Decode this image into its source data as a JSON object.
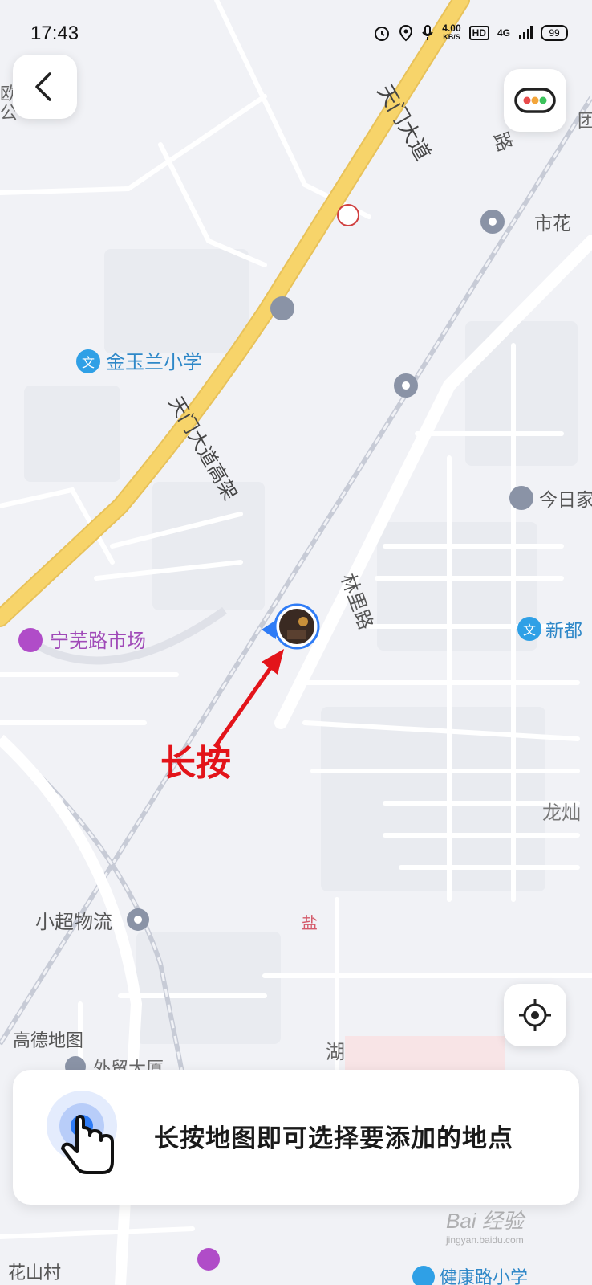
{
  "status_bar": {
    "time": "17:43",
    "network_speed_value": "4.00",
    "network_speed_unit": "KB/S",
    "hd_badge": "HD",
    "network_type": "4G",
    "battery": "99",
    "icons": [
      "alarm-icon",
      "location-icon",
      "microphone-icon",
      "hd-icon",
      "signal-icon",
      "battery-icon"
    ]
  },
  "map": {
    "roads": {
      "tianmen_avenue": "天门大道",
      "tianmen_elevated": "天门大道高架",
      "linli_road": "林里路",
      "partial_road": "路",
      "partial_lake": "湖"
    },
    "pois": {
      "jinyulan_school": "金玉兰小学",
      "ningwu_market": "宁芜路市场",
      "xiaochao_logistics": "小超物流",
      "gaode_map": "高德地图",
      "waimao_building": "外贸大厦",
      "huashan_village": "花山村",
      "jiankang_school": "健康路小学",
      "jinri_home": "今日家",
      "xindu": "新都",
      "longshan": "龙灿",
      "shihua": "市花",
      "partial_left_1": "欧",
      "partial_left_2": "公",
      "partial_right": "团",
      "red_marker": "盐"
    }
  },
  "annotation": {
    "text": "长按",
    "color": "#e3141a"
  },
  "hint_card": {
    "text": "长按地图即可选择要添加的地点"
  },
  "watermark": {
    "text": "Bai 经验",
    "subtext": "jingyan.baidu.com"
  },
  "colors": {
    "map_background": "#f1f2f6",
    "highway": "#f7d46a",
    "poi_blue": "#2fa0e6",
    "poi_purple": "#b04cc8",
    "poi_gray": "#8a93a6",
    "accent_blue": "#2f7cf6"
  }
}
